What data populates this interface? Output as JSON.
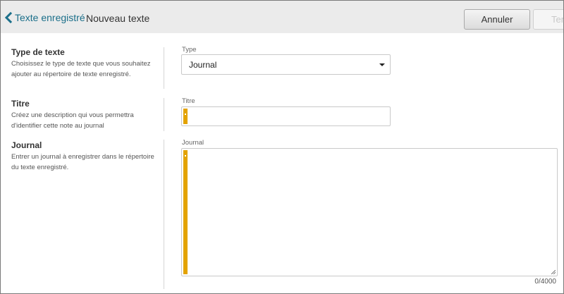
{
  "header": {
    "back_label": "Texte enregistré",
    "title": "Nouveau texte",
    "cancel_label": "Annuler",
    "finish_label": "Ter"
  },
  "sections": {
    "type": {
      "title": "Type de texte",
      "description": "Choisissez le type de texte que vous souhaitez ajouter au répertoire de texte enregistré.",
      "field_label": "Type",
      "selected": "Journal"
    },
    "titre": {
      "title": "Titre",
      "description": "Créez une description qui vous permettra d'identifier cette note au journal",
      "field_label": "Titre",
      "value": ""
    },
    "journal": {
      "title": "Journal",
      "description": "Entrer un journal à enregistrer dans le répertoire du texte enregistré.",
      "field_label": "Journal",
      "value": "",
      "counter": "0/4000"
    }
  },
  "colors": {
    "accent_link": "#1b6f8a",
    "required_bar": "#e3a300",
    "header_bg": "#ebebeb"
  },
  "icons": {
    "back": "chevron-left-icon",
    "select": "chevron-down-icon",
    "resize": "resize-handle-icon"
  }
}
